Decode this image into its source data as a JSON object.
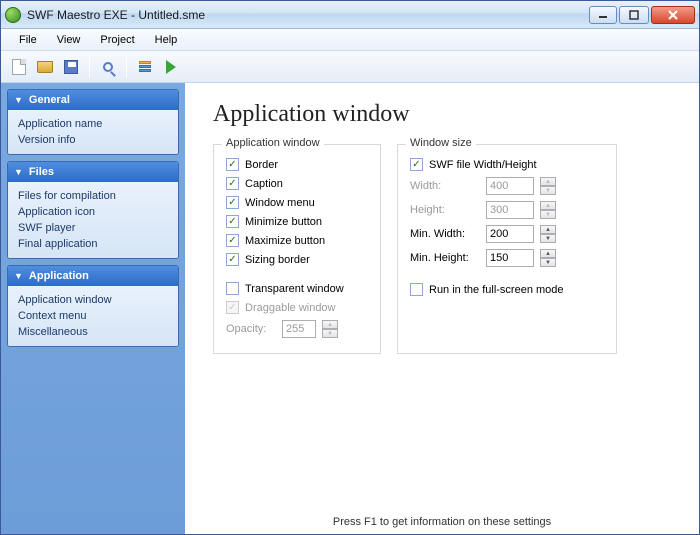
{
  "window": {
    "title": "SWF Maestro EXE - Untitled.sme"
  },
  "menu": {
    "file": "File",
    "view": "View",
    "project": "Project",
    "help": "Help"
  },
  "sidebar": {
    "general": {
      "title": "General",
      "app_name": "Application name",
      "version": "Version info"
    },
    "files": {
      "title": "Files",
      "compile": "Files for compilation",
      "icon": "Application icon",
      "swf": "SWF player",
      "final": "Final application"
    },
    "application": {
      "title": "Application",
      "window": "Application window",
      "context": "Context menu",
      "misc": "Miscellaneous"
    }
  },
  "page": {
    "title": "Application window",
    "group_window": "Application window",
    "group_size": "Window size",
    "chk_border": "Border",
    "chk_caption": "Caption",
    "chk_menu": "Window menu",
    "chk_min": "Minimize button",
    "chk_max": "Maximize button",
    "chk_sizing": "Sizing border",
    "chk_transparent": "Transparent window",
    "chk_draggable": "Draggable window",
    "lbl_opacity": "Opacity:",
    "val_opacity": "255",
    "chk_swf_wh": "SWF file Width/Height",
    "lbl_width": "Width:",
    "val_width": "400",
    "lbl_height": "Height:",
    "val_height": "300",
    "lbl_minw": "Min. Width:",
    "val_minw": "200",
    "lbl_minh": "Min. Height:",
    "val_minh": "150",
    "chk_fullscreen": "Run in the full-screen mode"
  },
  "status": "Press F1 to get information on these settings"
}
